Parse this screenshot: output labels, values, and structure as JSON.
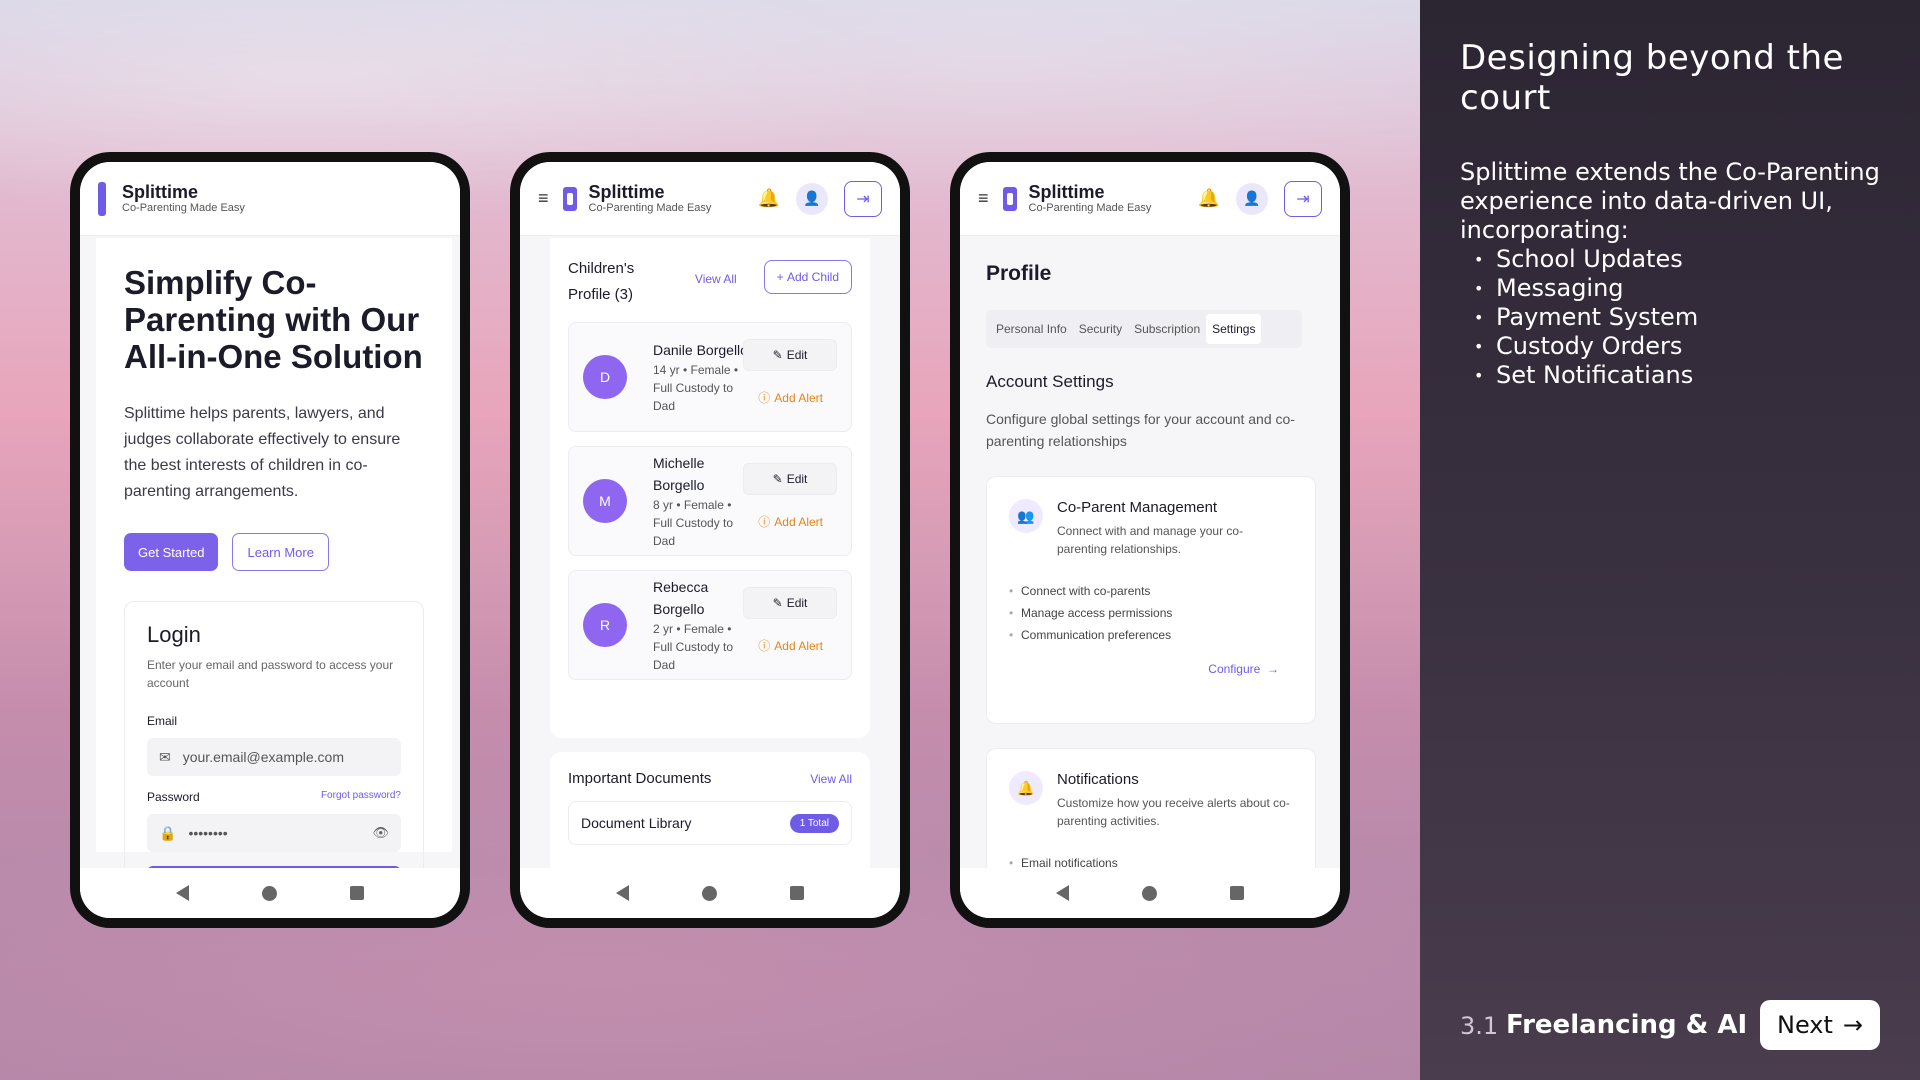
{
  "panel": {
    "title": "Designing beyond the court",
    "intro": "Splittime extends the Co-Parenting experience into data-driven UI, incorporating:",
    "bullets": [
      "School Updates",
      "Messaging",
      "Payment System",
      "Custody Orders",
      "Set Notificatians"
    ],
    "section_number": "3.1",
    "section_title": "Freelancing & AI",
    "next_label": "Next"
  },
  "app": {
    "name": "Splittime",
    "tagline": "Co-Parenting Made Easy"
  },
  "landing": {
    "headline": "Simplify Co-Parenting with Our All-in-One Solution",
    "description": "Splittime helps parents, lawyers, and judges collaborate effectively to ensure the best interests of children in co-parenting arrangements.",
    "get_started": "Get Started",
    "learn_more": "Learn More",
    "login": {
      "title": "Login",
      "subtitle": "Enter your email and password to access your account",
      "email_label": "Email",
      "email_placeholder": "your.email@example.com",
      "password_label": "Password",
      "forgot": "Forgot password?",
      "password_value": "••••••••"
    }
  },
  "children": {
    "title": "Children's Profile (3)",
    "view_all": "View All",
    "add_child": "Add Child",
    "edit_label": "Edit",
    "alert_label": "Add Alert",
    "items": [
      {
        "initial": "D",
        "name": "Danile Borgello",
        "meta": "14 yr • Female • Full Custody to Dad"
      },
      {
        "initial": "M",
        "name": "Michelle Borgello",
        "meta": "8 yr • Female • Full Custody to Dad"
      },
      {
        "initial": "R",
        "name": "Rebecca Borgello",
        "meta": "2 yr • Female • Full Custody to Dad"
      }
    ],
    "documents": {
      "title": "Important Documents",
      "view_all": "View All",
      "library": "Document Library",
      "count": "1 Total"
    }
  },
  "profile": {
    "title": "Profile",
    "tabs": [
      "Personal Info",
      "Security",
      "Subscription",
      "Settings"
    ],
    "active_tab": "Settings",
    "section_title": "Account Settings",
    "section_desc": "Configure global settings for your account and co-parenting relationships",
    "coparent": {
      "title": "Co-Parent Management",
      "desc": "Connect with and manage your co-parenting relationships.",
      "items": [
        "Connect with co-parents",
        "Manage access permissions",
        "Communication preferences"
      ],
      "action": "Configure"
    },
    "notifications": {
      "title": "Notifications",
      "desc": "Customize how you receive alerts about co-parenting activities.",
      "items": [
        "Email notifications"
      ]
    }
  },
  "colors": {
    "accent": "#6f5be6",
    "warning": "#e58418"
  }
}
